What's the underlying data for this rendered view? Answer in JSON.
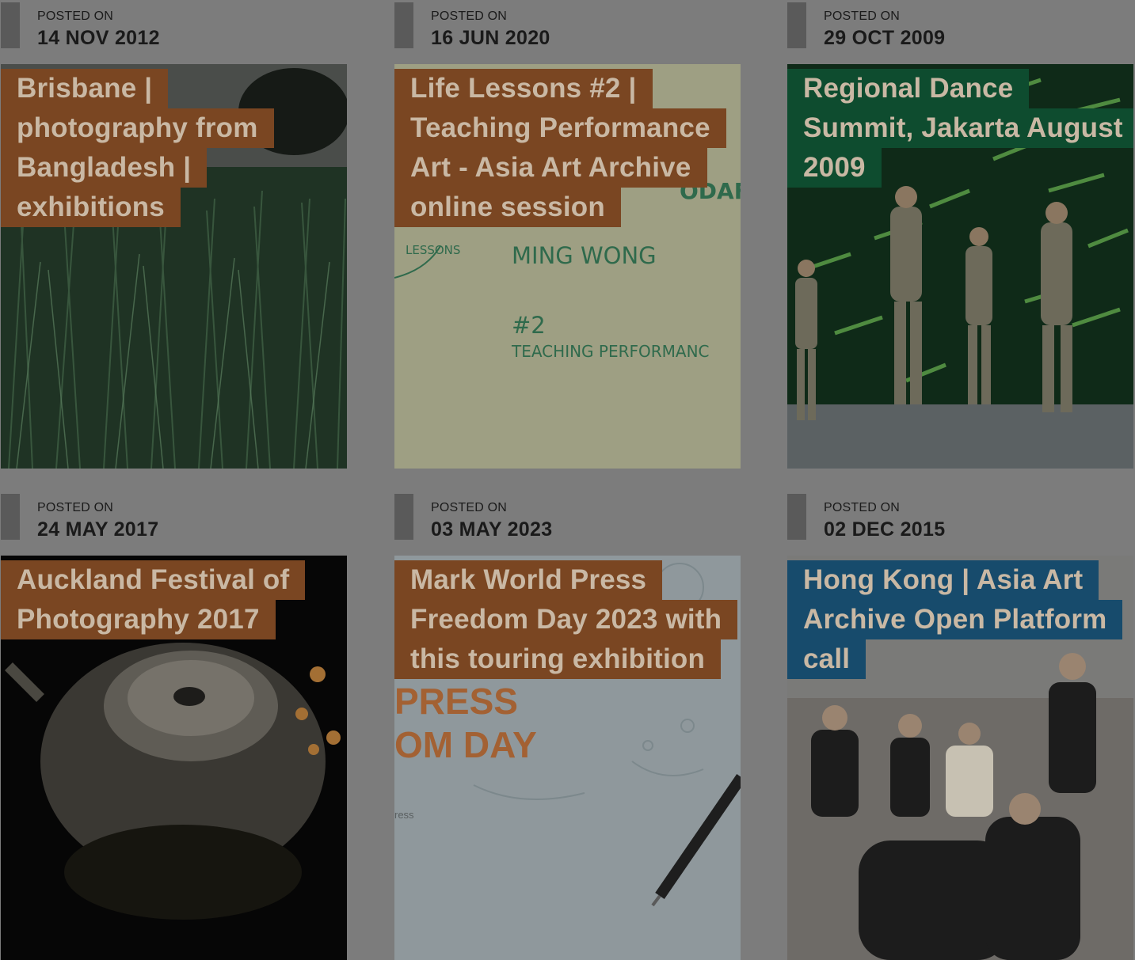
{
  "posts": [
    {
      "posted_label": "POSTED ON",
      "date": "14 NOV 2012",
      "title_lines": [
        "Brisbane |",
        "photography from",
        "Bangladesh |",
        "exhibitions"
      ],
      "title_color": "#7a4622",
      "image_text": {}
    },
    {
      "posted_label": "POSTED ON",
      "date": "16 JUN 2020",
      "title_lines": [
        "Life Lessons #2 |",
        "Teaching Performance",
        "Art - Asia Art Archive",
        "online session"
      ],
      "title_color": "#7a4622",
      "image_text": {
        "fragment": "ODAF",
        "lessons": "LESSONS",
        "artist": "MING WONG",
        "number": "#2",
        "subtitle": "TEACHING PERFORMANC"
      }
    },
    {
      "posted_label": "POSTED ON",
      "date": "29 OCT 2009",
      "title_lines": [
        "Regional Dance",
        "Summit, Jakarta August",
        "2009"
      ],
      "title_color": "#0e4c2f",
      "image_text": {}
    },
    {
      "posted_label": "POSTED ON",
      "date": "24 MAY 2017",
      "title_lines": [
        "Auckland Festival of",
        "Photography 2017"
      ],
      "title_color": "#7a4622",
      "image_text": {}
    },
    {
      "posted_label": "POSTED ON",
      "date": "03 MAY 2023",
      "title_lines": [
        "Mark World Press",
        "Freedom Day 2023 with",
        "this touring exhibition"
      ],
      "title_color": "#7a4622",
      "image_text": {
        "line1": "PRESS",
        "line2": "OM DAY",
        "small": "ress"
      }
    },
    {
      "posted_label": "POSTED ON",
      "date": "02 DEC 2015",
      "title_lines": [
        "Hong Kong | Asia Art",
        "Archive Open Platform",
        "call"
      ],
      "title_color": "#174b6c",
      "image_text": {}
    }
  ]
}
